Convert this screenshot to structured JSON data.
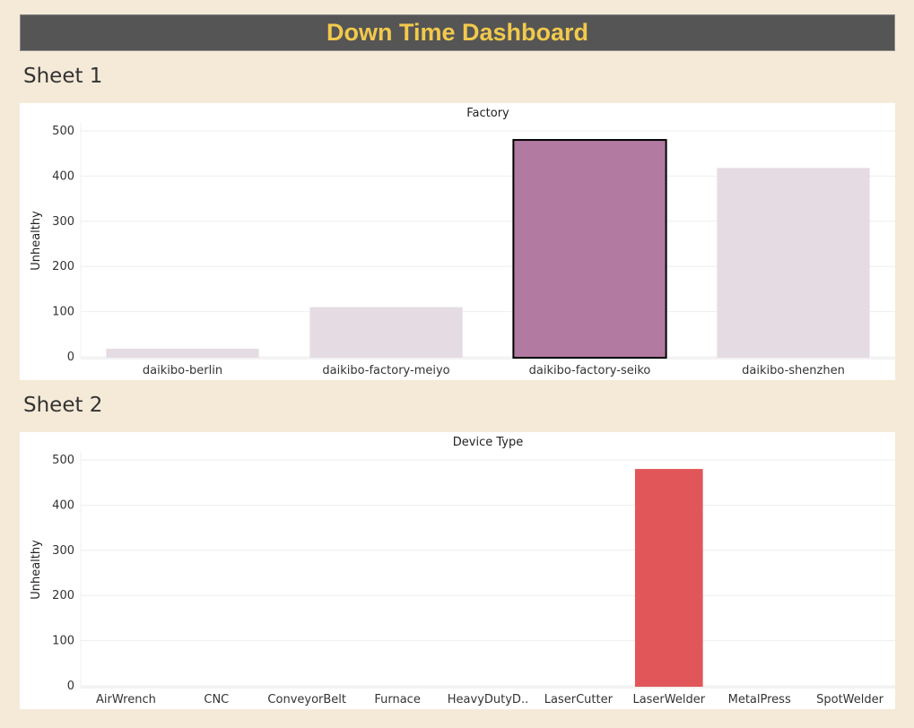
{
  "dashboard": {
    "title": "Down Time Dashboard"
  },
  "sheets": [
    {
      "title": "Sheet 1"
    },
    {
      "title": "Sheet 2"
    }
  ],
  "colors": {
    "background": "#f5ead8",
    "title_bar": "#555555",
    "title_text": "#f2c94c",
    "sheet1_selected": "#b27aa1",
    "sheet1_unselected": "#e5dce3",
    "sheet2_bar": "#e15759"
  },
  "chart_data": [
    {
      "type": "bar",
      "title": "Factory",
      "ylabel": "Unhealthy",
      "ylim": [
        0,
        500
      ],
      "yticks": [
        0,
        100,
        200,
        300,
        400,
        500
      ],
      "categories": [
        "daikibo-berlin",
        "daikibo-factory-meiyo",
        "daikibo-factory-seiko",
        "daikibo-shenzhen"
      ],
      "values": [
        18,
        110,
        480,
        418
      ],
      "selected": "daikibo-factory-seiko",
      "grid": true
    },
    {
      "type": "bar",
      "title": "Device Type",
      "ylabel": "Unhealthy",
      "ylim": [
        0,
        500
      ],
      "yticks": [
        0,
        100,
        200,
        300,
        400,
        500
      ],
      "categories": [
        "AirWrench",
        "CNC",
        "ConveyorBelt",
        "Furnace",
        "HeavyDutyD..",
        "LaserCutter",
        "LaserWelder",
        "MetalPress",
        "SpotWelder"
      ],
      "values": [
        0,
        0,
        0,
        0,
        0,
        0,
        480,
        0,
        0
      ],
      "grid": true
    }
  ]
}
